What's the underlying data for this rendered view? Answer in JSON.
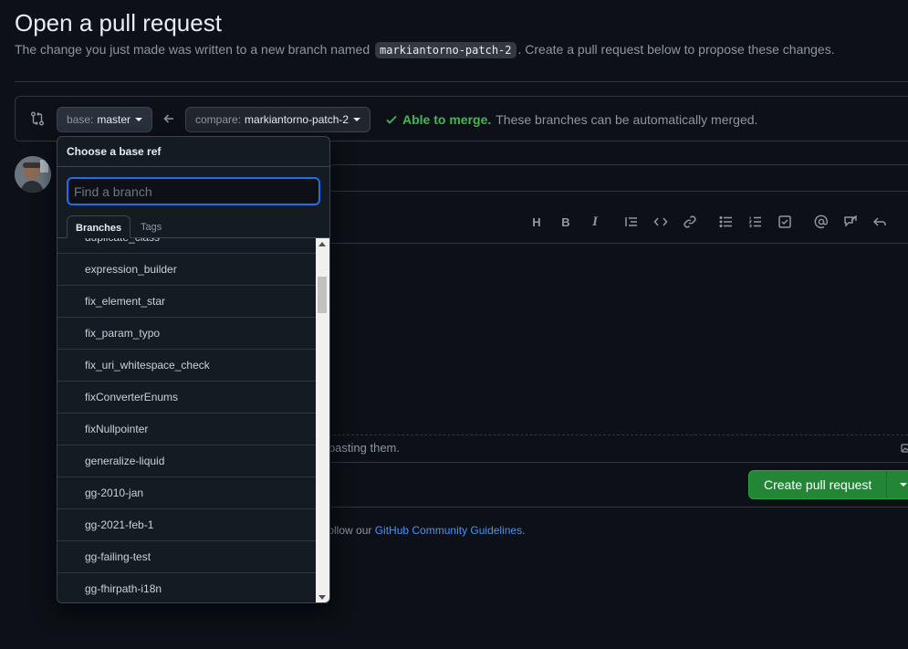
{
  "header": {
    "title": "Open a pull request",
    "subtitle_before": "The change you just made was written to a new branch named ",
    "branch_name": "markiantorno-patch-2",
    "subtitle_after": ". Create a pull request below to propose these changes."
  },
  "range": {
    "base_key": "base:",
    "base_value": "master",
    "compare_key": "compare:",
    "compare_value": "markiantorno-patch-2",
    "merge_ok": "Able to merge.",
    "merge_msg": "These branches can be automatically merged."
  },
  "dropdown": {
    "title": "Choose a base ref",
    "filter_placeholder": "Find a branch",
    "tabs": [
      "Branches",
      "Tags"
    ],
    "items": [
      "duplicate_class",
      "expression_builder",
      "fix_element_star",
      "fix_param_typo",
      "fix_uri_whitespace_check",
      "fixConverterEnums",
      "fixNullpointer",
      "generalize-liquid",
      "gg-2010-jan",
      "gg-2021-feb-1",
      "gg-failing-test",
      "gg-fhirpath-i18n"
    ]
  },
  "editor": {
    "attach_hint": "r pasting them.",
    "create_button": "Create pull request",
    "guidelines_before": "l follow our ",
    "guidelines_link": "GitHub Community Guidelines",
    "guidelines_after": "."
  },
  "colors": {
    "accent": "#1f6feb",
    "success": "#3fb950",
    "primary_button": "#238636",
    "link": "#4493f8"
  }
}
